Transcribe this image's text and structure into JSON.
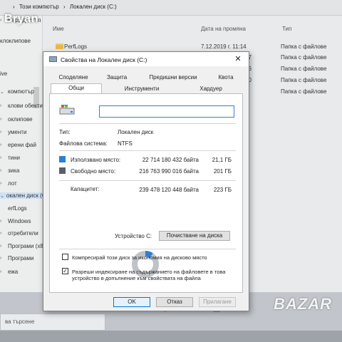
{
  "watermark": "Bryan",
  "explorer": {
    "breadcrumb": [
      "Този компютър",
      "Локален диск (C:)"
    ],
    "columns": {
      "name": "Име",
      "date": "Дата на промяна",
      "type": "Тип"
    },
    "rows": [
      {
        "name": "PerfLogs",
        "date": "7.12.2019 г. 11:14",
        "type": "Папка с файлове"
      },
      {
        "name": "",
        "date": "07",
        "type": "Папка с файлове"
      },
      {
        "name": "",
        "date": "56",
        "type": "Папка с файлове"
      },
      {
        "name": "",
        "date": "30",
        "type": "Папка с файлове"
      },
      {
        "name": "",
        "date": "6",
        "type": "Папка с файлове"
      }
    ],
    "nav": [
      "Бърз достъп",
      "клоклипове",
      "ive",
      "компютър",
      "клови обекти",
      "оклипове",
      "ументи",
      "ерени фай",
      "тини",
      "зика",
      "лот",
      "окален диск (C",
      "erfLogs",
      "Windows",
      "отребители",
      "Програми (x8",
      "Програми",
      "ежа"
    ],
    "search_placeholder": "ва търсене"
  },
  "dialog": {
    "title": "Свойства на Локален диск (C:)",
    "close": "✕",
    "tabs_row1": [
      "Споделяне",
      "Защита",
      "Предишни версии",
      "Квота"
    ],
    "tabs_row2": [
      "Общи",
      "Инструменти",
      "Хардуер"
    ],
    "name_value": "",
    "type_label": "Тип:",
    "type_value": "Локален диск",
    "fs_label": "Файлова система:",
    "fs_value": "NTFS",
    "used_label": "Използвано място:",
    "used_bytes": "22 714 180 432 байта",
    "used_gb": "21,1 ГБ",
    "free_label": "Свободно място:",
    "free_bytes": "216 763 990 016 байта",
    "free_gb": "201 ГБ",
    "capacity_label": "Капацитет:",
    "capacity_bytes": "239 478 120 448 байта",
    "capacity_gb": "223 ГБ",
    "used_fraction": 0.095,
    "used_color": "#2c7fd6",
    "free_color": "#bfc2c6",
    "device_label": "Устройство C:",
    "cleanup_button": "Почистване на диска",
    "compress_label": "Компресирай този диск за икономия на дисково място",
    "compress_checked": false,
    "index_label": "Разреши индексиране на съдържанието на файловете в това устройство в допълнение към свойствата на файла",
    "index_checked": true,
    "ok": "OK",
    "cancel": "Отказ",
    "apply": "Прилагане"
  },
  "bazar_logo": "BAZAR"
}
